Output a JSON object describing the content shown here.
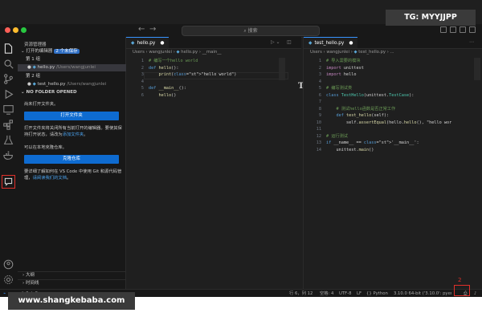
{
  "window": {
    "search_placeholder": "搜索"
  },
  "sidebar": {
    "title": "资源管理器",
    "open_editors": {
      "label": "打开的编辑器",
      "badge": "2 个未保存"
    },
    "group1": {
      "label": "第 1 组",
      "file": "hello.py",
      "path": "/Users/wangjunlei"
    },
    "group2": {
      "label": "第 2 组",
      "file": "test_hello.py",
      "path": "/Users/wangjunlei"
    },
    "no_folder": "NO FOLDER OPENED",
    "no_folder_msg": "尚未打开文件夹。",
    "open_folder_btn": "打开文件夹",
    "open_folder_note": "打开文件夹将关闭所有当前打开的编辑器。要使其保持打开状态，请改为",
    "add_folder_link": "添加文件夹",
    "clone_msg": "可以在本地克隆仓库。",
    "clone_btn": "克隆仓库",
    "git_msg": "要详细了解如何在 VS Code 中使用 Git 和源代码管理，",
    "git_link": "请阅读我们的文档",
    "outline": "大纲",
    "timeline": "时间线"
  },
  "editor1": {
    "tab": "hello.py",
    "breadcrumb": [
      "Users",
      "wangjunlei",
      "hello.py",
      "__main__"
    ],
    "lines": [
      {
        "n": "1",
        "t": "# 编写一个hello world"
      },
      {
        "n": "2",
        "t": "def hello():"
      },
      {
        "n": "3",
        "t": "    print(\"hello world\")"
      },
      {
        "n": "4",
        "t": ""
      },
      {
        "n": "5",
        "t": "def __main__():"
      },
      {
        "n": "6",
        "t": "    hello()"
      }
    ]
  },
  "editor2": {
    "tab": "test_hello.py",
    "breadcrumb": [
      "Users",
      "wangjunlei",
      "test_hello.py",
      "..."
    ],
    "lines": [
      {
        "n": "1",
        "t": "# 导入需要的模块"
      },
      {
        "n": "2",
        "t": "import unittest"
      },
      {
        "n": "3",
        "t": "import hello"
      },
      {
        "n": "4",
        "t": ""
      },
      {
        "n": "5",
        "t": "# 编写测试类"
      },
      {
        "n": "6",
        "t": "class TestHello(unittest.TestCase):"
      },
      {
        "n": "7",
        "t": ""
      },
      {
        "n": "8",
        "t": "    # 测试hello函数是否正常工作"
      },
      {
        "n": "9",
        "t": "    def test_hello(self):"
      },
      {
        "n": "10",
        "t": "        self.assertEqual(hello.hello(), \"hello wor"
      },
      {
        "n": "11",
        "t": ""
      },
      {
        "n": "12",
        "t": "# 运行测试"
      },
      {
        "n": "13",
        "t": "if __name__ == '__main__':"
      },
      {
        "n": "14",
        "t": "    unittest.main()"
      }
    ]
  },
  "statusbar": {
    "left": "⊗ 0 ⚠ 0",
    "position": "行 6，列 12",
    "spaces": "空格: 4",
    "encoding": "UTF-8",
    "eol": "LF",
    "language": "Python",
    "interpreter": "3.10.0 64-bit ('3.10.0': pyenv)"
  },
  "annotations": {
    "label1": "1",
    "label2": "2"
  },
  "watermarks": {
    "top_right": "TG: MYYJJPP",
    "bottom_left": "www.shangkebaba.com"
  }
}
